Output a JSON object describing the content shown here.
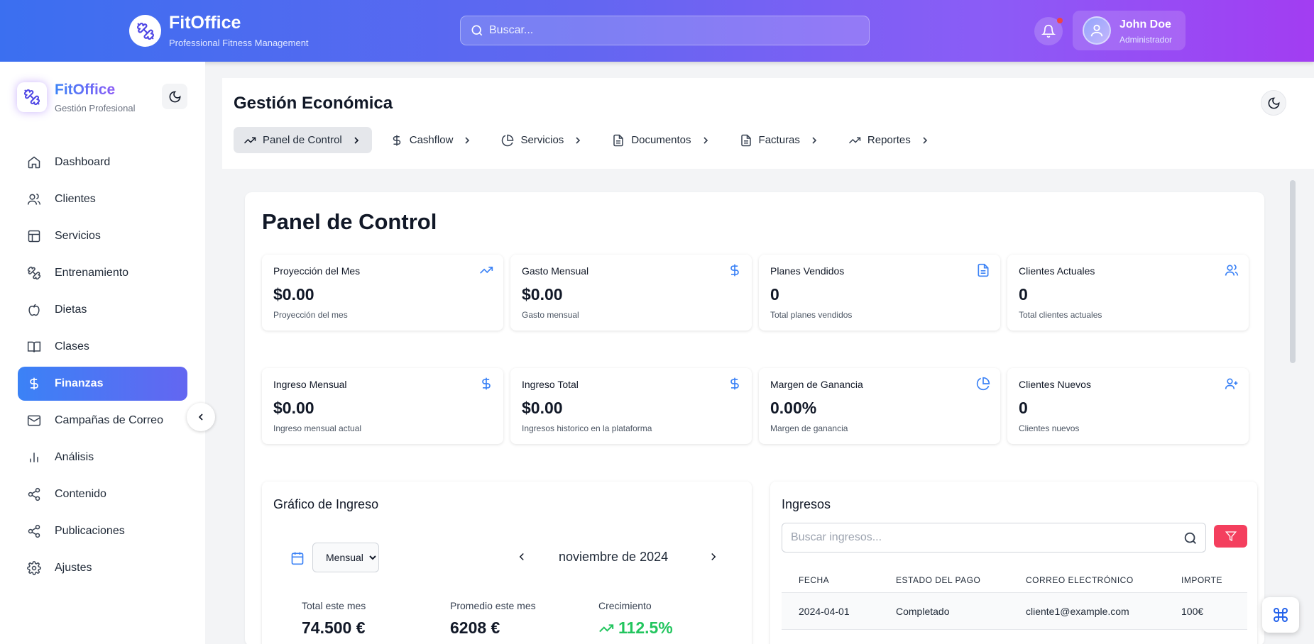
{
  "header": {
    "brand_title": "FitOffice",
    "brand_subtitle": "Professional Fitness Management",
    "search_placeholder": "Buscar...",
    "user_name": "John Doe",
    "user_role": "Administrador"
  },
  "sidebar": {
    "title": "FitOffice",
    "subtitle": "Gestión Profesional",
    "items": [
      {
        "label": "Dashboard",
        "icon": "home-icon"
      },
      {
        "label": "Clientes",
        "icon": "users-icon"
      },
      {
        "label": "Servicios",
        "icon": "layout-icon"
      },
      {
        "label": "Entrenamiento",
        "icon": "dumbbell-icon"
      },
      {
        "label": "Dietas",
        "icon": "apple-icon"
      },
      {
        "label": "Clases",
        "icon": "book-icon"
      },
      {
        "label": "Finanzas",
        "icon": "dollar-icon",
        "active": true
      },
      {
        "label": "Campañas de Correo",
        "icon": "mail-icon"
      },
      {
        "label": "Análisis",
        "icon": "bar-chart-icon"
      },
      {
        "label": "Contenido",
        "icon": "share-icon"
      },
      {
        "label": "Publicaciones",
        "icon": "share-icon"
      },
      {
        "label": "Ajustes",
        "icon": "gear-icon"
      }
    ]
  },
  "main": {
    "title": "Gestión Económica",
    "tabs": [
      {
        "label": "Panel de Control",
        "icon": "trending-up-icon",
        "active": true
      },
      {
        "label": "Cashflow",
        "icon": "dollar-icon"
      },
      {
        "label": "Servicios",
        "icon": "pie-chart-icon"
      },
      {
        "label": "Documentos",
        "icon": "file-icon"
      },
      {
        "label": "Facturas",
        "icon": "file-icon"
      },
      {
        "label": "Reportes",
        "icon": "trending-up-icon"
      }
    ]
  },
  "panel": {
    "title": "Panel de Control",
    "stats": [
      {
        "label": "Proyección del Mes",
        "value": "$0.00",
        "sub": "Proyección del mes",
        "icon": "trending-up-icon"
      },
      {
        "label": "Gasto Mensual",
        "value": "$0.00",
        "sub": "Gasto mensual",
        "icon": "dollar-icon"
      },
      {
        "label": "Planes Vendidos",
        "value": "0",
        "sub": "Total planes vendidos",
        "icon": "file-icon"
      },
      {
        "label": "Clientes Actuales",
        "value": "0",
        "sub": "Total clientes actuales",
        "icon": "users-icon"
      },
      {
        "label": "Ingreso Mensual",
        "value": "$0.00",
        "sub": "Ingreso mensual actual",
        "icon": "dollar-icon"
      },
      {
        "label": "Ingreso Total",
        "value": "$0.00",
        "sub": "Ingresos historico en la plataforma",
        "icon": "dollar-icon"
      },
      {
        "label": "Margen de Ganancia",
        "value": "0.00%",
        "sub": "Margen de ganancia",
        "icon": "pie-chart-icon"
      },
      {
        "label": "Clientes Nuevos",
        "value": "0",
        "sub": "Clientes nuevos",
        "icon": "user-plus-icon"
      }
    ]
  },
  "income_chart": {
    "title": "Gráfico de Ingreso",
    "period": "Mensual",
    "month_label": "noviembre de 2024",
    "metrics": [
      {
        "label": "Total este mes",
        "value": "74.500 €"
      },
      {
        "label": "Promedio este mes",
        "value": "6208 €"
      },
      {
        "label": "Crecimiento",
        "value": "112.5%"
      }
    ]
  },
  "income_table": {
    "title": "Ingresos",
    "search_placeholder": "Buscar ingresos...",
    "columns": [
      "FECHA",
      "ESTADO DEL PAGO",
      "CORREO ELECTRÓNICO",
      "IMPORTE"
    ],
    "rows": [
      [
        "2024-04-01",
        "Completado",
        "cliente1@example.com",
        "100€"
      ]
    ]
  },
  "colors": {
    "accent_blue": "#3b82f6",
    "accent_purple": "#8b5cf6",
    "growth_green": "#22c55e",
    "filter_red": "#f43f5e",
    "notification_dot": "#ef4444"
  }
}
